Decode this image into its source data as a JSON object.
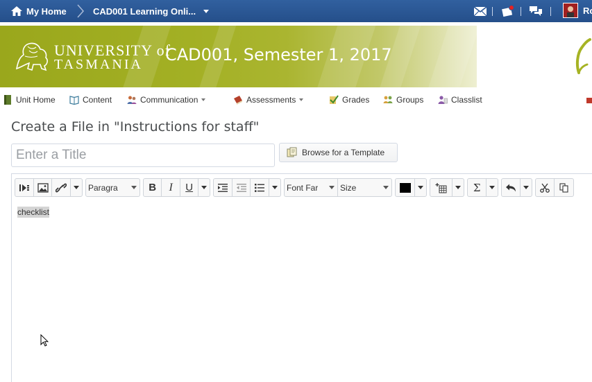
{
  "topbar": {
    "home_label": "My Home",
    "course_label": "CAD001 Learning Onli...",
    "icons": [
      "home-icon",
      "mail-icon",
      "alert-icon",
      "chat-icon"
    ],
    "user_initials": "Ro",
    "background": "#2b5797"
  },
  "banner": {
    "university_line1": "UNIVERSITY of",
    "university_line2": "TASMANIA",
    "course_title": "CAD001, Semester 1, 2017",
    "color": "#9aa71c"
  },
  "course_nav": {
    "items": [
      {
        "label": "Unit Home",
        "icon": "book-icon"
      },
      {
        "label": "Content",
        "icon": "open-book-icon"
      },
      {
        "label": "Communication",
        "icon": "people-icon"
      },
      {
        "label": "Assessments",
        "icon": "assessment-book-icon"
      },
      {
        "label": "Grades",
        "icon": "grades-check-icon"
      },
      {
        "label": "Groups",
        "icon": "groups-icon"
      },
      {
        "label": "Classlist",
        "icon": "classlist-icon"
      }
    ]
  },
  "page": {
    "title": "Create a File in \"Instructions for staff\"",
    "title_placeholder": "Enter a Title",
    "browse_template_label": "Browse for a Template"
  },
  "editor": {
    "paragraph_select": "Paragra",
    "font_family_select": "Font Far",
    "font_size_select": "Size",
    "text_color": "#000000",
    "content": "checklist"
  }
}
